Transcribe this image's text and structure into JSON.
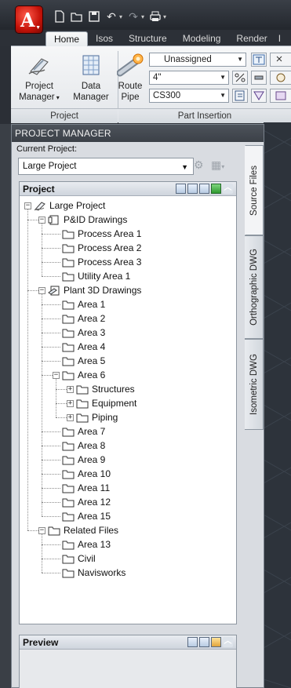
{
  "ribbon": {
    "tabs": [
      "Home",
      "Isos",
      "Structure",
      "Modeling",
      "Render",
      "I"
    ],
    "active_tab": "Home",
    "buttons": {
      "project_manager": [
        "Project",
        "Manager"
      ],
      "data_manager": [
        "Data",
        "Manager"
      ],
      "route_pipe": [
        "Route",
        "Pipe"
      ]
    },
    "combos": {
      "line_number": "Unassigned",
      "size": "4\"",
      "spec": "CS300"
    },
    "panels": [
      "Project",
      "Part Insertion"
    ]
  },
  "project_manager": {
    "title": "PROJECT MANAGER",
    "current_project_label": "Current Project:",
    "current_project": "Large Project",
    "tree_header": "Project",
    "side_tabs": [
      "Source Files",
      "Orthographic DWG",
      "Isometric DWG"
    ],
    "preview_header": "Preview",
    "tree": [
      {
        "label": "Large Project",
        "level": 0,
        "toggle": "-",
        "icon": "project"
      },
      {
        "label": "P&ID Drawings",
        "level": 1,
        "toggle": "-",
        "icon": "pid"
      },
      {
        "label": "Process Area 1",
        "level": 2,
        "icon": "folder"
      },
      {
        "label": "Process Area 2",
        "level": 2,
        "icon": "folder"
      },
      {
        "label": "Process Area 3",
        "level": 2,
        "icon": "folder"
      },
      {
        "label": "Utility Area 1",
        "level": 2,
        "icon": "folder"
      },
      {
        "label": "Plant 3D Drawings",
        "level": 1,
        "toggle": "-",
        "icon": "plant3d"
      },
      {
        "label": "Area 1",
        "level": 2,
        "icon": "folder"
      },
      {
        "label": "Area 2",
        "level": 2,
        "icon": "folder"
      },
      {
        "label": "Area 3",
        "level": 2,
        "icon": "folder"
      },
      {
        "label": "Area 4",
        "level": 2,
        "icon": "folder"
      },
      {
        "label": "Area 5",
        "level": 2,
        "icon": "folder"
      },
      {
        "label": "Area 6",
        "level": 2,
        "toggle": "-",
        "icon": "folder"
      },
      {
        "label": "Structures",
        "level": 3,
        "toggle": "+",
        "icon": "folder"
      },
      {
        "label": "Equipment",
        "level": 3,
        "toggle": "+",
        "icon": "folder"
      },
      {
        "label": "Piping",
        "level": 3,
        "toggle": "+",
        "icon": "folder"
      },
      {
        "label": "Area 7",
        "level": 2,
        "icon": "folder"
      },
      {
        "label": "Area 8",
        "level": 2,
        "icon": "folder"
      },
      {
        "label": "Area 9",
        "level": 2,
        "icon": "folder"
      },
      {
        "label": "Area 10",
        "level": 2,
        "icon": "folder"
      },
      {
        "label": "Area 11",
        "level": 2,
        "icon": "folder"
      },
      {
        "label": "Area 12",
        "level": 2,
        "icon": "folder"
      },
      {
        "label": "Area 15",
        "level": 2,
        "icon": "folder"
      },
      {
        "label": "Related Files",
        "level": 1,
        "toggle": "-",
        "icon": "folder"
      },
      {
        "label": "Area 13",
        "level": 2,
        "icon": "folder"
      },
      {
        "label": "Civil",
        "level": 2,
        "icon": "folder"
      },
      {
        "label": "Navisworks",
        "level": 2,
        "icon": "folder"
      }
    ]
  }
}
